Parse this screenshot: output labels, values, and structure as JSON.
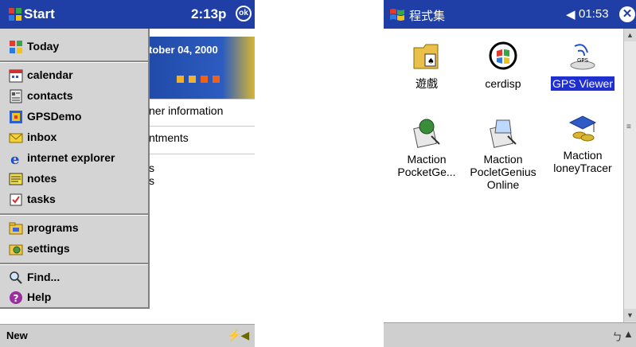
{
  "left": {
    "title_bar": {
      "start_label": "Start",
      "clock": "2:13p",
      "ok_label": "ok"
    },
    "today": {
      "date": "tober 04, 2000",
      "lines": [
        "ner information",
        "ntments",
        "s",
        "s"
      ]
    },
    "start_menu": {
      "items": [
        {
          "label": "Today",
          "icon": "today-icon"
        },
        {
          "label": "calendar",
          "icon": "calendar-icon"
        },
        {
          "label": "contacts",
          "icon": "contacts-icon"
        },
        {
          "label": "GPSDemo",
          "icon": "gpsdemo-icon"
        },
        {
          "label": "inbox",
          "icon": "inbox-icon"
        },
        {
          "label": "internet explorer",
          "icon": "internet-explorer-icon"
        },
        {
          "label": "notes",
          "icon": "notes-icon"
        },
        {
          "label": "tasks",
          "icon": "tasks-icon"
        },
        {
          "label": "programs",
          "icon": "programs-icon"
        },
        {
          "label": "settings",
          "icon": "settings-icon"
        },
        {
          "label": "Find...",
          "icon": "find-icon"
        },
        {
          "label": "Help",
          "icon": "help-icon"
        }
      ]
    },
    "bottom_bar": {
      "new_label": "New"
    }
  },
  "right": {
    "title_bar": {
      "title": "程式集",
      "clock": "01:53"
    },
    "icons": [
      {
        "label": "遊戲",
        "icon": "games-folder-icon",
        "selected": false
      },
      {
        "label": "cerdisp",
        "icon": "cerdisp-icon",
        "selected": false
      },
      {
        "label": "GPS Viewer",
        "icon": "gps-viewer-icon",
        "selected": true
      },
      {
        "label": "Maction PocketGe...",
        "icon": "maction-pocketgenius-icon",
        "selected": false
      },
      {
        "label": "Maction PocletGenius Online",
        "icon": "maction-online-icon",
        "selected": false
      },
      {
        "label": "Maction loneyTracer",
        "icon": "maction-moneytracer-icon",
        "selected": false
      }
    ]
  },
  "colors": {
    "title_bar": "#1f3fa6",
    "menu_bg": "#d4d4d4",
    "selection": "#1f2fd0",
    "bar_bg": "#cfcfcf"
  }
}
